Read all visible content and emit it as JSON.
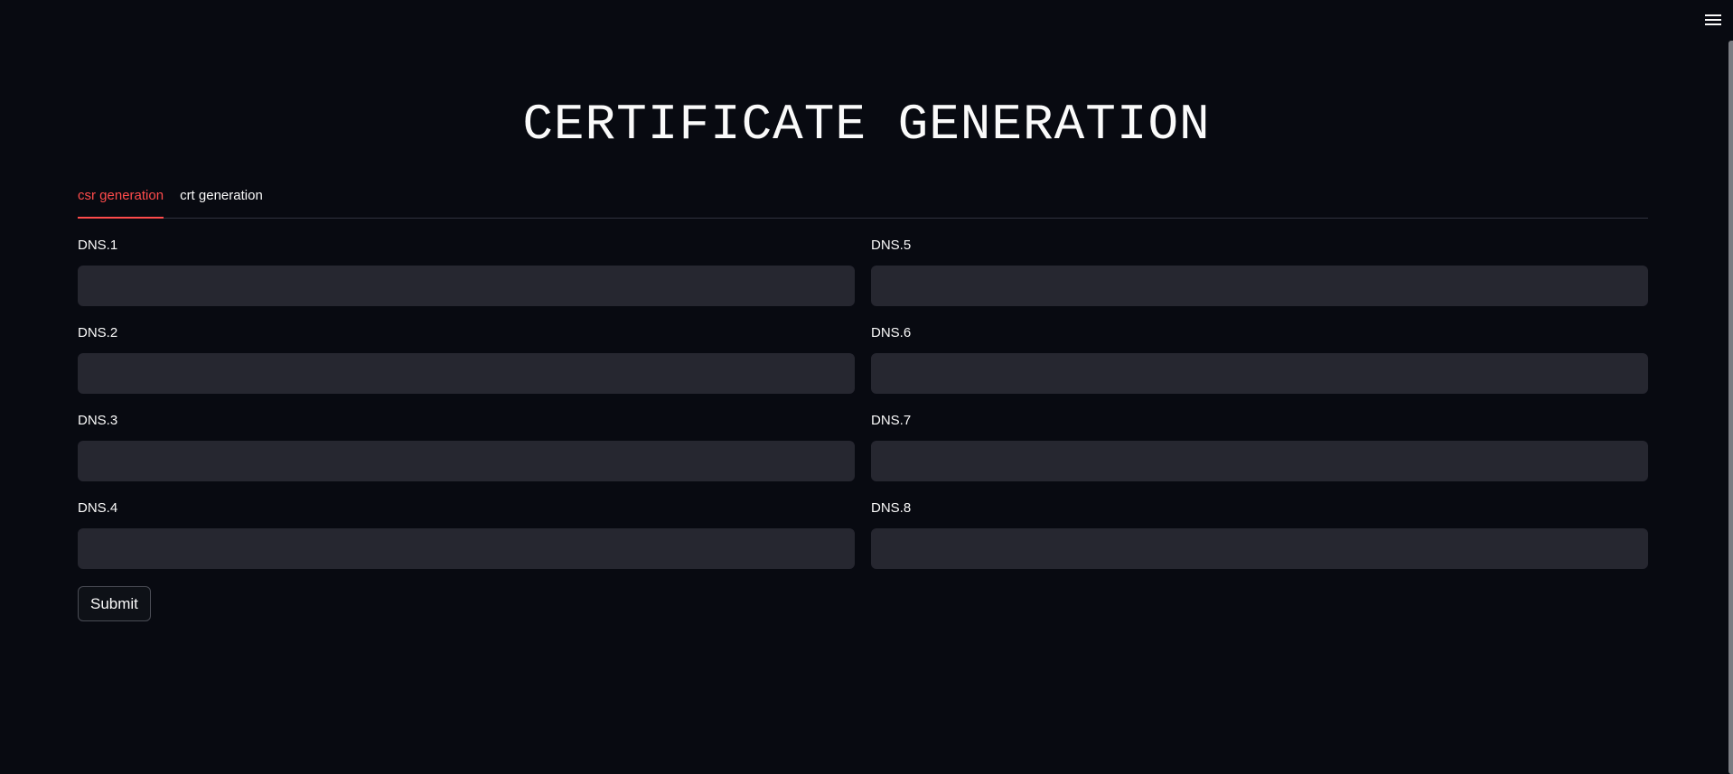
{
  "header": {
    "menu_icon": "hamburger-menu-icon"
  },
  "page": {
    "title": "CERTIFICATE GENERATION"
  },
  "tabs": [
    {
      "label": "csr generation",
      "active": true
    },
    {
      "label": "crt generation",
      "active": false
    }
  ],
  "form": {
    "left_fields": [
      {
        "label": "DNS.1",
        "value": ""
      },
      {
        "label": "DNS.2",
        "value": ""
      },
      {
        "label": "DNS.3",
        "value": ""
      },
      {
        "label": "DNS.4",
        "value": ""
      }
    ],
    "right_fields": [
      {
        "label": "DNS.5",
        "value": ""
      },
      {
        "label": "DNS.6",
        "value": ""
      },
      {
        "label": "DNS.7",
        "value": ""
      },
      {
        "label": "DNS.8",
        "value": ""
      }
    ],
    "submit_label": "Submit"
  },
  "colors": {
    "background": "#080a11",
    "accent": "#ff4b4b",
    "input_background": "#262730",
    "text": "#fafafa"
  }
}
